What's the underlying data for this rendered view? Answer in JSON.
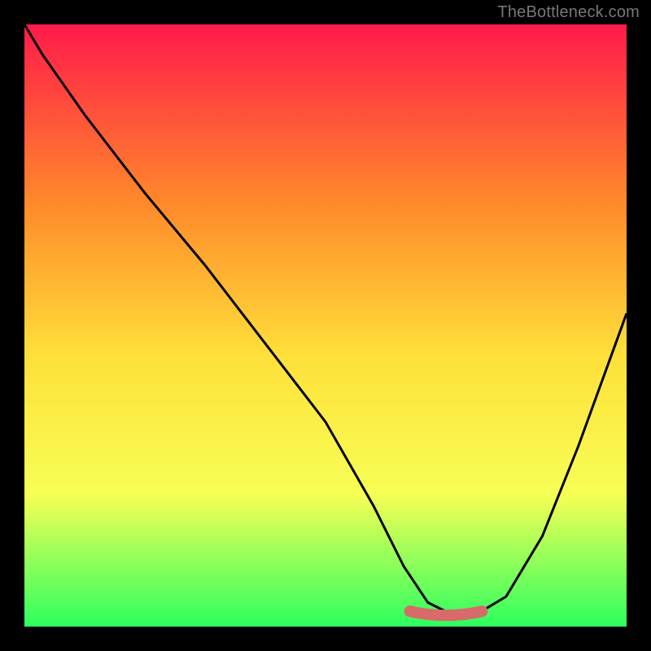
{
  "watermark": "TheBottleneck.com",
  "colors": {
    "bg_black": "#000000",
    "gradient_top": "#ff1a4a",
    "gradient_mid_upper": "#ff8a2a",
    "gradient_mid": "#ffe03a",
    "gradient_lower": "#f7ff55",
    "gradient_bottom": "#2cff5f",
    "curve": "#000000",
    "valley_highlight": "#d86a6a"
  },
  "chart_data": {
    "type": "line",
    "title": "",
    "xlabel": "",
    "ylabel": "",
    "xlim": [
      0,
      100
    ],
    "ylim": [
      0,
      100
    ],
    "series": [
      {
        "name": "bottleneck-curve",
        "x": [
          0,
          3,
          10,
          20,
          30,
          40,
          50,
          58,
          63,
          67,
          71,
          75,
          80,
          86,
          92,
          100
        ],
        "values": [
          100,
          95,
          85,
          72,
          60,
          47,
          34,
          20,
          10,
          4,
          2,
          2,
          5,
          15,
          30,
          52
        ]
      }
    ],
    "annotations": [
      {
        "name": "optimal-range",
        "x_start": 64,
        "x_end": 76,
        "y": 2
      }
    ]
  }
}
